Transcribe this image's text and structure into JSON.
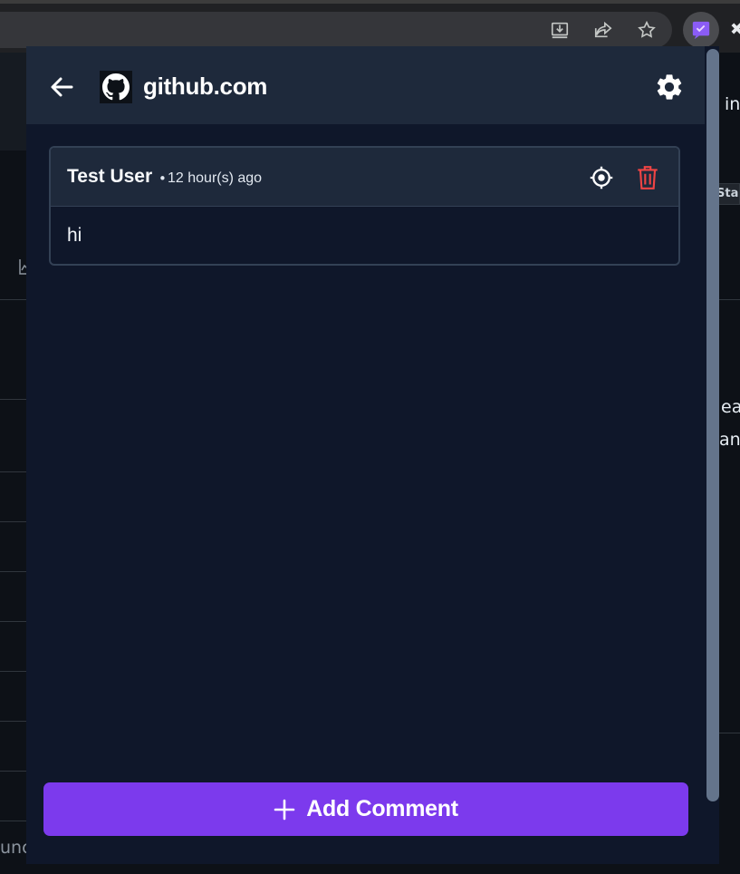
{
  "browser": {
    "toolbar_icons": [
      "install-app-icon",
      "share-icon",
      "bookmark-star-icon"
    ],
    "extension_icon": "comment-extension-icon"
  },
  "background_page": {
    "right_fragments": [
      "in",
      "Star",
      "ea",
      "an"
    ],
    "left_fragments": [
      "unc"
    ]
  },
  "popup": {
    "header": {
      "site_title": "github.com",
      "icons": [
        "back-arrow-icon",
        "github-logo-icon",
        "gear-icon"
      ]
    },
    "comments": [
      {
        "author": "Test User",
        "separator": "•",
        "time": "12 hour(s) ago",
        "body": "hi",
        "icons": [
          "locate-icon",
          "trash-icon"
        ]
      }
    ],
    "add_button_label": "Add Comment"
  },
  "colors": {
    "accent": "#7c3aed",
    "danger": "#ef4444",
    "panel": "#0f172a",
    "header": "#1e293b",
    "border": "#334155"
  }
}
